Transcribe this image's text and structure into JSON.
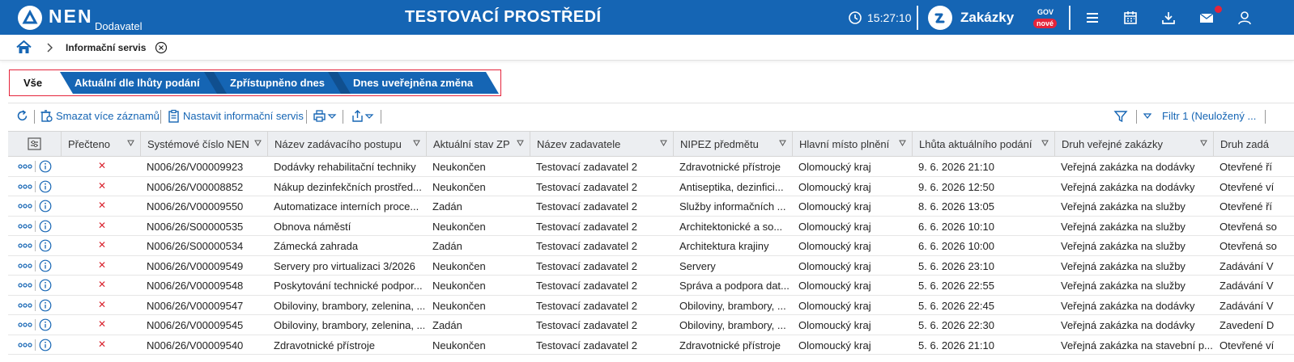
{
  "header": {
    "logo": "NEN",
    "logo_sub": "Dodavatel",
    "environment": "TESTOVACÍ PROSTŘEDÍ",
    "time": "15:27:10",
    "zakazky_label": "Zakázky",
    "zakazky_gov": "GOV",
    "zakazky_badge": "nové",
    "brand_color": "#1565b4",
    "icons": [
      "clock-icon",
      "menu-icon",
      "calendar-icon",
      "download-icon",
      "mail-icon",
      "user-icon"
    ]
  },
  "breadcrumb": {
    "current": "Informační servis"
  },
  "tabs": [
    {
      "label": "Vše",
      "active": true
    },
    {
      "label": "Aktuální dle lhůty podání",
      "active": false
    },
    {
      "label": "Zpřístupněno dnes",
      "active": false
    },
    {
      "label": "Dnes uveřejněna změna",
      "active": false
    }
  ],
  "toolbar": {
    "delete_label": "Smazat více záznamů",
    "setup_label": "Nastavit informační servis",
    "filter_label": "Filtr 1 (Neuložený ..."
  },
  "table": {
    "columns": [
      "Přečteno",
      "Systémové číslo NEN",
      "Název zadávacího postupu",
      "Aktuální stav ZP",
      "Název zadavatele",
      "NIPEZ předmětu",
      "Hlavní místo plnění",
      "Lhůta aktuálního podání",
      "Druh veřejné zakázky",
      "Druh zadá"
    ],
    "rows": [
      [
        "✕",
        "N006/26/V00009923",
        "Dodávky rehabilitační techniky",
        "Neukončen",
        "Testovací zadavatel 2",
        "Zdravotnické přístroje",
        "Olomoucký kraj",
        "9. 6. 2026 21:10",
        "Veřejná zakázka na dodávky",
        "Otevřené ří"
      ],
      [
        "✕",
        "N006/26/V00008852",
        "Nákup dezinfekčních prostřed...",
        "Neukončen",
        "Testovací zadavatel 2",
        "Antiseptika, dezinfici...",
        "Olomoucký kraj",
        "9. 6. 2026 12:50",
        "Veřejná zakázka na dodávky",
        "Otevřené ví"
      ],
      [
        "✕",
        "N006/26/V00009550",
        "Automatizace interních proce...",
        "Zadán",
        "Testovací zadavatel 2",
        "Služby informačních ...",
        "Olomoucký kraj",
        "8. 6. 2026 13:05",
        "Veřejná zakázka na služby",
        "Otevřené ří"
      ],
      [
        "✕",
        "N006/26/S00000535",
        "Obnova náměstí",
        "Neukončen",
        "Testovací zadavatel 2",
        "Architektonické a so...",
        "Olomoucký kraj",
        "6. 6. 2026 10:10",
        "Veřejná zakázka na služby",
        "Otevřená so"
      ],
      [
        "✕",
        "N006/26/S00000534",
        "Zámecká zahrada",
        "Zadán",
        "Testovací zadavatel 2",
        "Architektura krajiny",
        "Olomoucký kraj",
        "6. 6. 2026 10:00",
        "Veřejná zakázka na služby",
        "Otevřená so"
      ],
      [
        "✕",
        "N006/26/V00009549",
        "Servery pro virtualizaci 3/2026",
        "Neukončen",
        "Testovací zadavatel 2",
        "Servery",
        "Olomoucký kraj",
        "5. 6. 2026 23:10",
        "Veřejná zakázka na služby",
        "Zadávání V"
      ],
      [
        "✕",
        "N006/26/V00009548",
        "Poskytování technické podpor...",
        "Neukončen",
        "Testovací zadavatel 2",
        "Správa a podpora dat...",
        "Olomoucký kraj",
        "5. 6. 2026 22:55",
        "Veřejná zakázka na služby",
        "Zadávání V"
      ],
      [
        "✕",
        "N006/26/V00009547",
        "Obiloviny, brambory, zelenina, ...",
        "Neukončen",
        "Testovací zadavatel 2",
        "Obiloviny, brambory, ...",
        "Olomoucký kraj",
        "5. 6. 2026 22:45",
        "Veřejná zakázka na dodávky",
        "Zadávání V"
      ],
      [
        "✕",
        "N006/26/V00009545",
        "Obiloviny, brambory, zelenina, ...",
        "Zadán",
        "Testovací zadavatel 2",
        "Obiloviny, brambory, ...",
        "Olomoucký kraj",
        "5. 6. 2026 22:30",
        "Veřejná zakázka na dodávky",
        "Zavedení D"
      ],
      [
        "✕",
        "N006/26/V00009540",
        "Zdravotnické přístroje",
        "Neukončen",
        "Testovací zadavatel 2",
        "Zdravotnické přístroje",
        "Olomoucký kraj",
        "5. 6. 2026 21:10",
        "Veřejná zakázka na stavební p...",
        "Otevřené ví"
      ]
    ]
  }
}
